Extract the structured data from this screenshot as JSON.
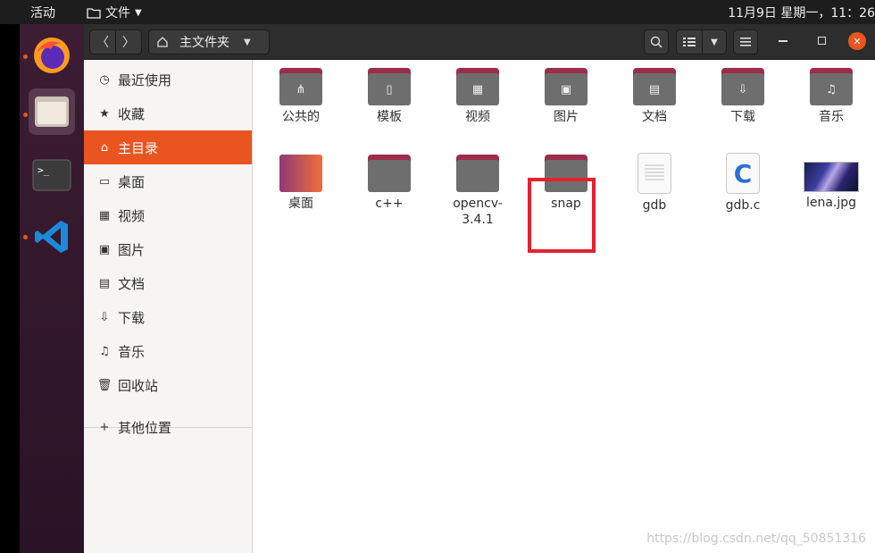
{
  "topbar": {
    "activities": "活动",
    "app_menu": "文件",
    "clock": "11月9日 星期一，11：26"
  },
  "dock": {
    "items": [
      {
        "name": "firefox",
        "running": true
      },
      {
        "name": "files",
        "running": true
      },
      {
        "name": "terminal",
        "running": false
      },
      {
        "name": "vscode",
        "running": true
      }
    ]
  },
  "headerbar": {
    "path_label": "主文件夹"
  },
  "sidebar": {
    "items": [
      {
        "label": "最近使用",
        "icon": "clock-icon"
      },
      {
        "label": "收藏",
        "icon": "star-icon"
      },
      {
        "label": "主目录",
        "icon": "home-icon",
        "active": true
      },
      {
        "label": "桌面",
        "icon": "desktop-icon"
      },
      {
        "label": "视频",
        "icon": "video-icon"
      },
      {
        "label": "图片",
        "icon": "picture-icon"
      },
      {
        "label": "文档",
        "icon": "document-icon"
      },
      {
        "label": "下载",
        "icon": "download-icon"
      },
      {
        "label": "音乐",
        "icon": "music-icon"
      },
      {
        "label": "回收站",
        "icon": "trash-icon"
      }
    ],
    "other_locations": "其他位置"
  },
  "files": [
    {
      "label": "公共的",
      "type": "folder",
      "emblem": "share-icon"
    },
    {
      "label": "模板",
      "type": "folder",
      "emblem": "template-icon"
    },
    {
      "label": "视频",
      "type": "folder",
      "emblem": "video-icon"
    },
    {
      "label": "图片",
      "type": "folder",
      "emblem": "picture-icon"
    },
    {
      "label": "文档",
      "type": "folder",
      "emblem": "document-icon"
    },
    {
      "label": "下载",
      "type": "folder",
      "emblem": "download-icon"
    },
    {
      "label": "音乐",
      "type": "folder",
      "emblem": "music-icon"
    },
    {
      "label": "桌面",
      "type": "desktop-folder",
      "emblem": ""
    },
    {
      "label": "c++",
      "type": "folder",
      "emblem": ""
    },
    {
      "label": "opencv-\n3.4.1",
      "type": "folder",
      "emblem": ""
    },
    {
      "label": "snap",
      "type": "folder",
      "emblem": ""
    },
    {
      "label": "gdb",
      "type": "text-file",
      "emblem": ""
    },
    {
      "label": "gdb.c",
      "type": "c-file",
      "emblem": ""
    },
    {
      "label": "lena.jpg",
      "type": "image-file",
      "emblem": ""
    }
  ],
  "watermark": "https://blog.csdn.net/qq_50851316",
  "colors": {
    "accent": "#e95420",
    "highlight_box": "#e3222d",
    "folder_tab": "#9c2d4b"
  }
}
